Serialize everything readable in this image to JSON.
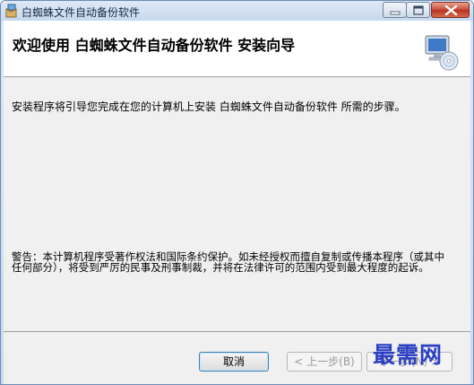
{
  "window": {
    "title": "白蜘蛛文件自动备份软件",
    "minimize_icon": "minimize-icon",
    "maximize_icon": "maximize-icon",
    "close_icon": "close-icon"
  },
  "header": {
    "title": "欢迎使用 白蜘蛛文件自动备份软件 安装向导",
    "icon": "computer-cd-icon"
  },
  "body": {
    "intro": "安装程序将引导您完成在您的计算机上安装 白蜘蛛文件自动备份软件 所需的步骤。",
    "warning": "警告：本计算机程序受著作权法和国际条约保护。如未经授权而擅自复制或传播本程序（或其中任何部分），将受到严厉的民事及刑事制裁，并将在法律许可的范围内受到最大程度的起诉。"
  },
  "footer": {
    "cancel_label": "取消",
    "back_label": "< 上一步(B)",
    "next_label": "下一步(N) >"
  },
  "watermark": "最需网",
  "colors": {
    "title_bar": "#c9d9ee",
    "close_button": "#c74a35",
    "watermark": "#2b3fc2",
    "panel": "#f0f0f0"
  }
}
